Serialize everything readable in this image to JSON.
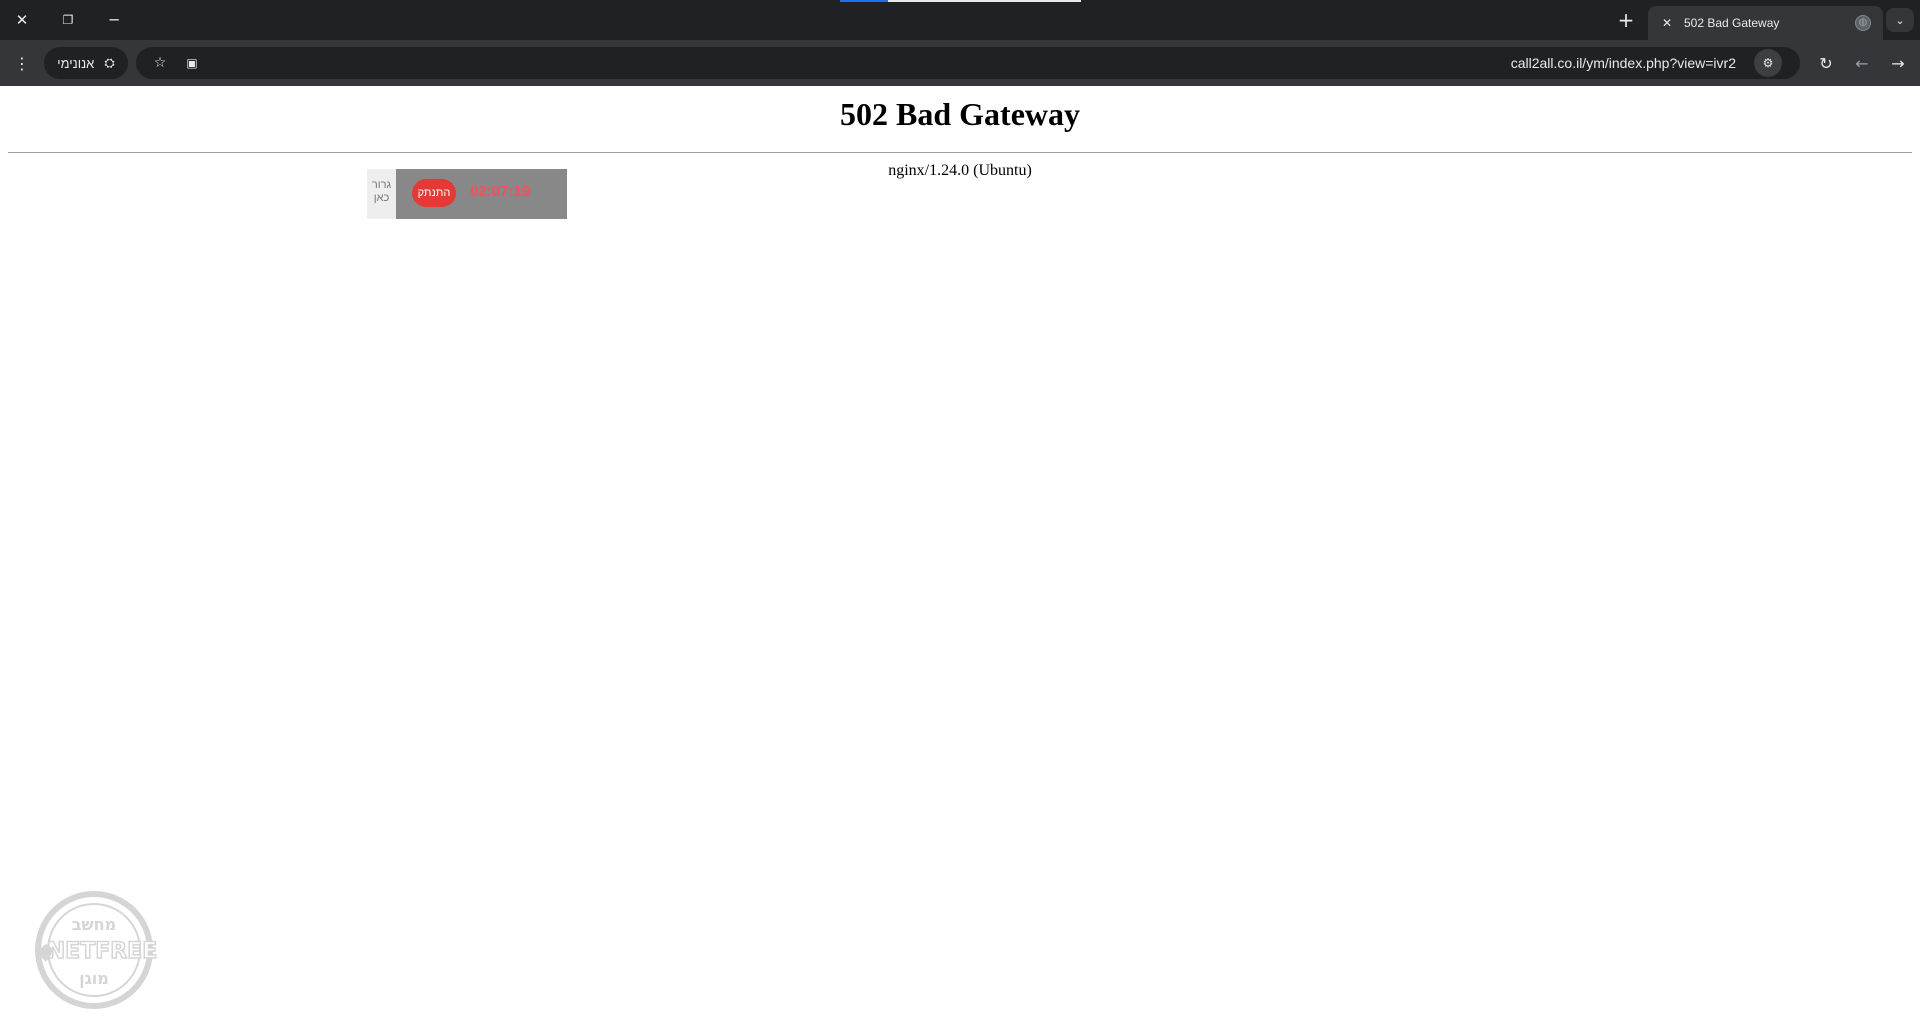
{
  "window": {
    "close_icon": "close-icon",
    "restore_icon": "restore-icon",
    "minimize_icon": "minimize-icon"
  },
  "loading": {
    "progress_fraction": 0.2
  },
  "tab": {
    "title": "502 Bad Gateway",
    "favicon": "globe-icon"
  },
  "toolbar": {
    "incognito_label": "אנונימי",
    "url": "call2all.co.il/ym/index.php?view=ivr2"
  },
  "page": {
    "title": "502 Bad Gateway",
    "server": "nginx/1.24.0 (Ubuntu)"
  },
  "widget": {
    "drag_label": "גרור כאן",
    "connect_label": "התנתק",
    "timer": "02:07:19",
    "colors": {
      "button": "#e53935",
      "timer": "#ff4d5a",
      "panel": "#888888"
    }
  },
  "watermark": {
    "top_text": "מחשב",
    "brand": "NETFREE",
    "bottom_text": "מוגן"
  }
}
